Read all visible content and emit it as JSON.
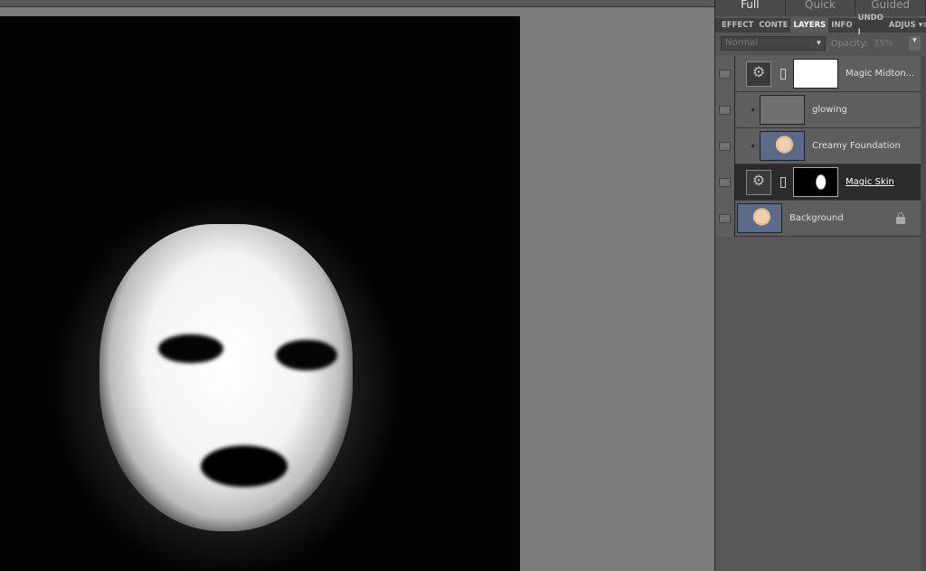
{
  "modes": [
    {
      "label": "Full",
      "active": true
    },
    {
      "label": "Quick",
      "active": false
    },
    {
      "label": "Guided",
      "active": false
    }
  ],
  "tabs": [
    {
      "label": "EFFECT"
    },
    {
      "label": "CONTE"
    },
    {
      "label": "LAYERS",
      "active": true
    },
    {
      "label": "INFO"
    },
    {
      "label": "UNDO I"
    },
    {
      "label": "ADJUS"
    }
  ],
  "tab_menu_icon": "panel-menu-icon",
  "options": {
    "blend_mode": "Normal",
    "opacity_label": "Opacity:",
    "opacity_value": "35%"
  },
  "layers": [
    {
      "name": "Magic Midton...",
      "type": "adjustment",
      "mask": "white"
    },
    {
      "name": "glowing",
      "type": "clipped",
      "thumb": "gray"
    },
    {
      "name": "Creamy Foundation",
      "type": "clipped",
      "thumb": "photo"
    },
    {
      "name": "Magic Skin",
      "type": "adjustment",
      "mask": "face",
      "selected": true
    },
    {
      "name": "Background",
      "type": "photo",
      "locked": true
    }
  ]
}
